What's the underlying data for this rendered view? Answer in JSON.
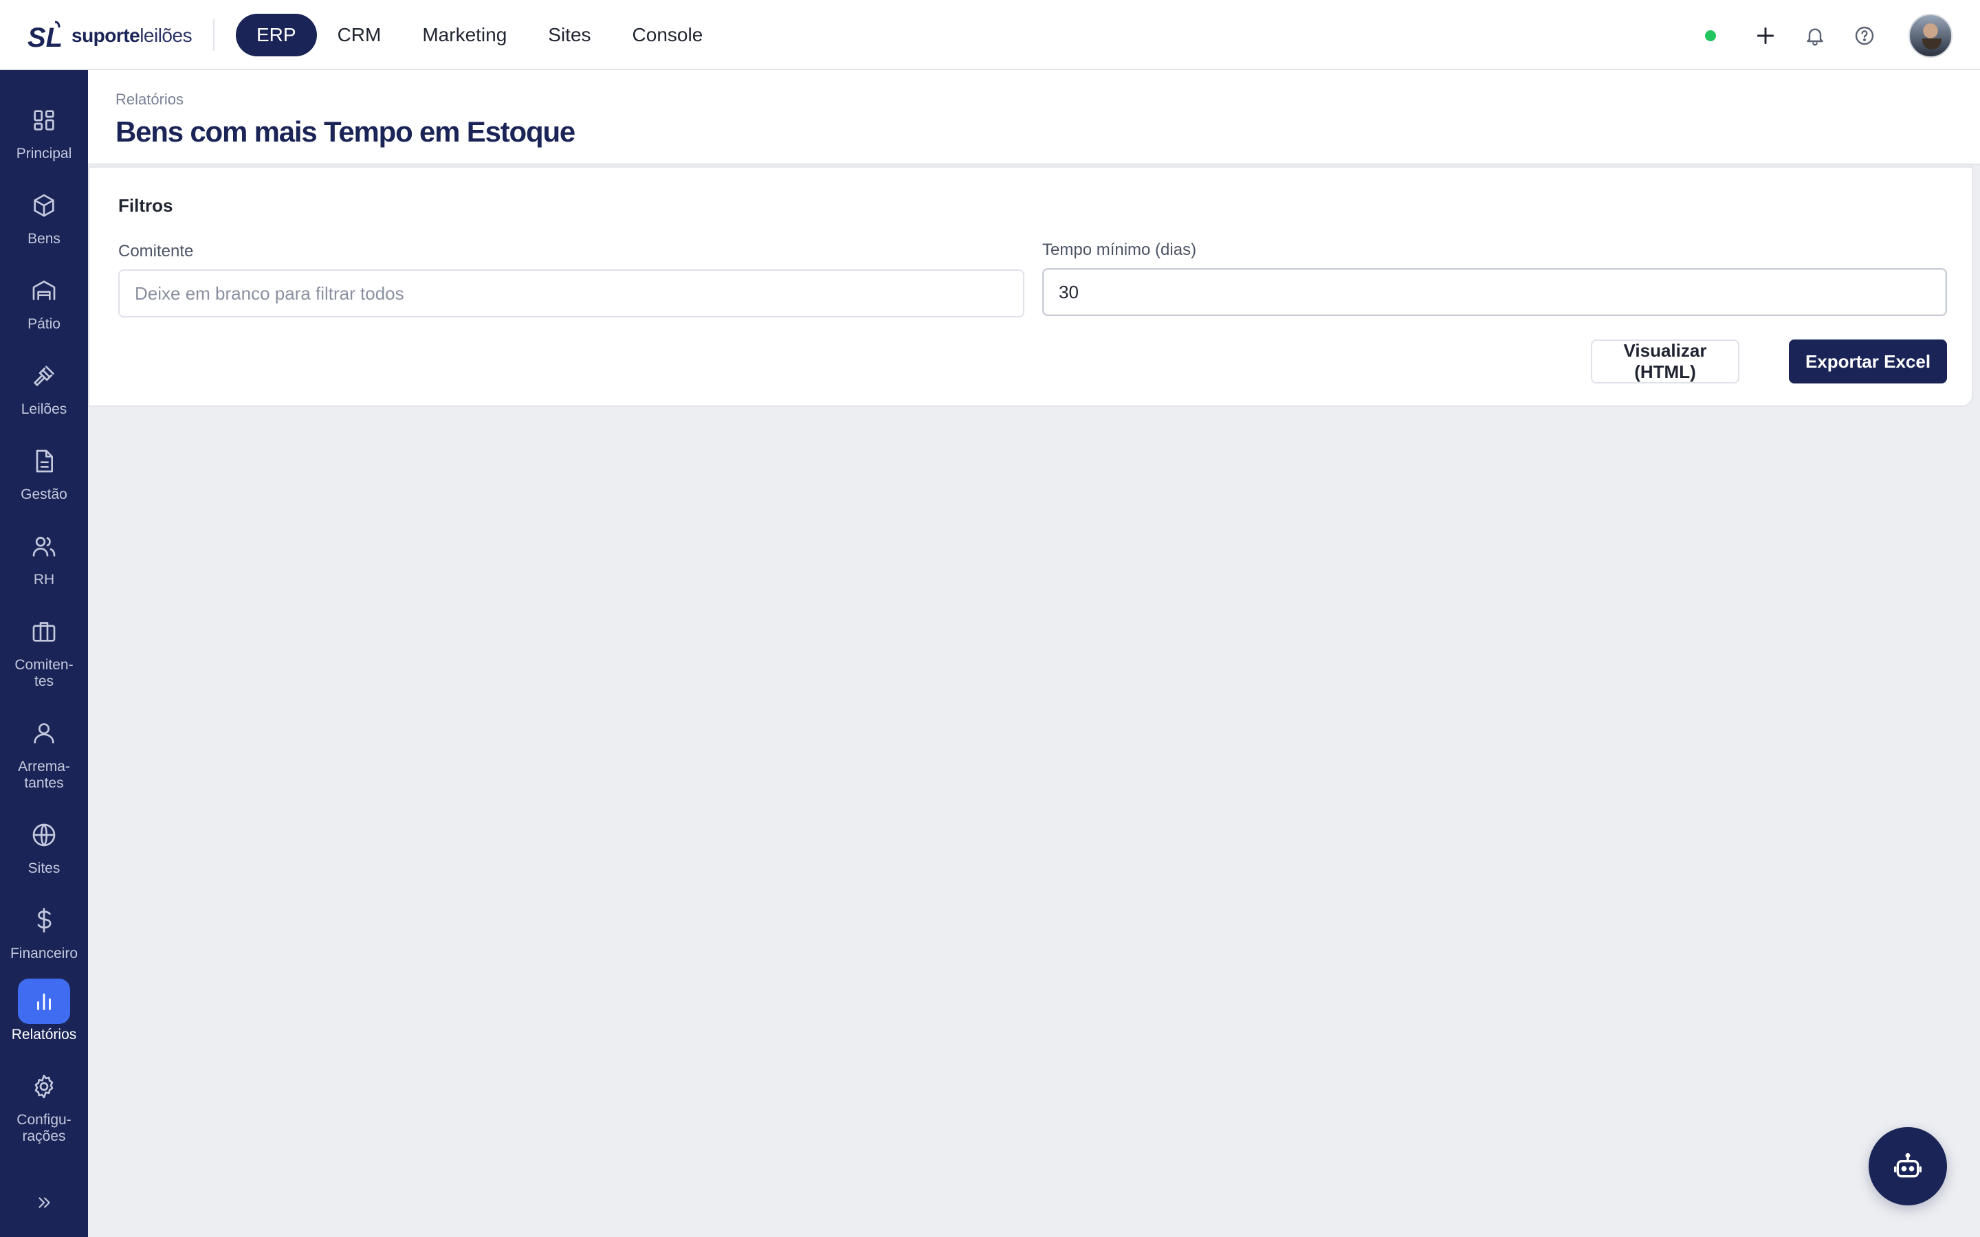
{
  "brand": {
    "bold": "suporte",
    "light": "leilões",
    "mark": "SL",
    "accent": "#1a2456"
  },
  "module_nav": [
    {
      "label": "ERP",
      "active": true
    },
    {
      "label": "CRM",
      "active": false
    },
    {
      "label": "Marketing",
      "active": false
    },
    {
      "label": "Sites",
      "active": false
    },
    {
      "label": "Console",
      "active": false
    }
  ],
  "topbar": {
    "status_color": "#22c55e",
    "icons": [
      "plus-icon",
      "bell-icon",
      "help-circle-icon",
      "user-avatar"
    ]
  },
  "sidebar": {
    "items": [
      {
        "label": "Principal",
        "icon": "grid-icon"
      },
      {
        "label": "Bens",
        "icon": "box-icon"
      },
      {
        "label": "Pátio",
        "icon": "warehouse-icon"
      },
      {
        "label": "Leilões",
        "icon": "gavel-icon"
      },
      {
        "label": "Gestão",
        "icon": "document-icon"
      },
      {
        "label": "RH",
        "icon": "users-icon"
      },
      {
        "label": "Comiten-\ntes",
        "icon": "briefcase-icon"
      },
      {
        "label": "Arrema-\ntantes",
        "icon": "user-icon"
      },
      {
        "label": "Sites",
        "icon": "globe-icon"
      },
      {
        "label": "Financeiro",
        "icon": "dollar-icon"
      },
      {
        "label": "Relatórios",
        "icon": "bar-chart-icon",
        "active": true
      },
      {
        "label": "Configu-\nrações",
        "icon": "settings-icon"
      }
    ],
    "collapse_icon": "chevrons-right-icon"
  },
  "page": {
    "breadcrumb": "Relatórios",
    "title": "Bens com mais Tempo em Estoque"
  },
  "filters": {
    "title": "Filtros",
    "comitente": {
      "label": "Comitente",
      "value": "",
      "placeholder": "Deixe em branco para filtrar todos"
    },
    "tempo_minimo": {
      "label": "Tempo mínimo (dias)",
      "value": "30",
      "placeholder": ""
    },
    "preview_button": "Visualizar (HTML)",
    "export_button": "Exportar Excel"
  },
  "assistant_fab": {
    "icon": "bot-icon"
  }
}
